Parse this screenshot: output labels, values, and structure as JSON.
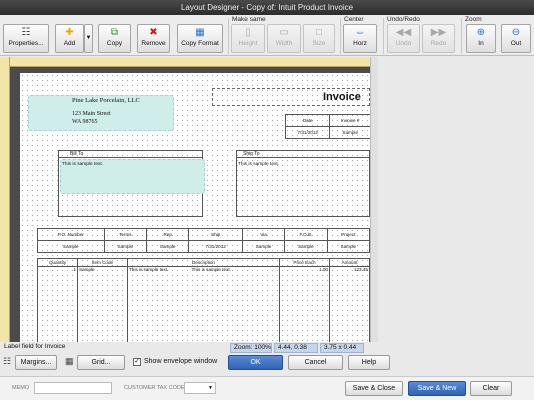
{
  "window": {
    "title": "Layout Designer - Copy of: Intuit Product Invoice"
  },
  "toolbar": {
    "properties": "Properties...",
    "add": "Add",
    "copy": "Copy",
    "remove": "Remove",
    "copy_format": "Copy Format",
    "make_same": {
      "label": "Make same",
      "height": "Height",
      "width": "Width",
      "size": "Size"
    },
    "center": {
      "label": "Center",
      "horz": "Horz"
    },
    "undo_redo": {
      "label": "Undo/Redo",
      "undo": "Undo",
      "redo": "Redo"
    },
    "zoom": {
      "label": "Zoom",
      "in": "In",
      "out": "Out"
    }
  },
  "invoice": {
    "company": {
      "name": "Pine Lake Porcelain, LLC",
      "street": "123 Main Street",
      "city": "WA 98765"
    },
    "title": "Invoice",
    "date_header": "Date",
    "invoice_header": "Invoice #",
    "date_value": "7/31/2012",
    "invoice_value": "Sample",
    "bill_to_label": "Bill To",
    "bill_to_text": "This is sample text.",
    "ship_to_label": "Ship To",
    "ship_to_text": "This is sample text.",
    "info_headers": [
      "P.O. Number",
      "Terms",
      "Rep",
      "Ship",
      "Via",
      "F.O.B.",
      "Project"
    ],
    "info_values": [
      "Sample",
      "Sample",
      "Sample",
      "7/31/2012",
      "Sample",
      "Sample",
      "Sample"
    ],
    "item_headers": [
      "Quantity",
      "Item Code",
      "Description",
      "Price Each",
      "Amount"
    ],
    "item_row": [
      "1",
      "Sample",
      "This is sample text.",
      "This is sample text.",
      "1.00",
      "123.45"
    ]
  },
  "status": {
    "field": "Label field for Invoice",
    "zoom": "Zoom: 100%",
    "position": "4.44, 0.38",
    "size": "3.75 x 0.44"
  },
  "dialog": {
    "margins": "Margins...",
    "grid": "Grid...",
    "envelope": "Show envelope window",
    "ok": "OK",
    "cancel": "Cancel",
    "help": "Help"
  },
  "form": {
    "memo": "MEMO",
    "customer_tax_code": "CUSTOMER TAX CODE",
    "save_close": "Save & Close",
    "save_new": "Save & New",
    "clear": "Clear"
  }
}
